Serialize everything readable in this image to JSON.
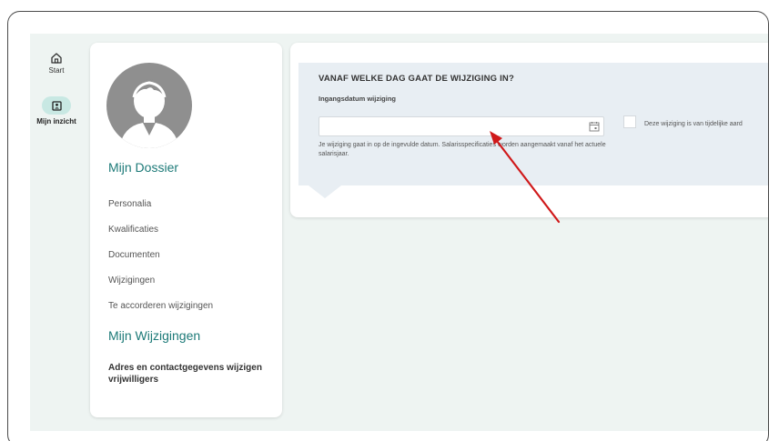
{
  "rail": {
    "items": [
      {
        "label": "Start",
        "icon": "home-icon"
      },
      {
        "label": "Mijn inzicht",
        "icon": "id-card-icon",
        "active": true
      }
    ]
  },
  "profile": {
    "avatar_icon": "avatar-icon",
    "dossier_title": "Mijn Dossier",
    "nav": [
      {
        "label": "Personalia"
      },
      {
        "label": "Kwalificaties"
      },
      {
        "label": "Documenten"
      },
      {
        "label": "Wijzigingen"
      },
      {
        "label": "Te accorderen wijzigingen"
      }
    ],
    "wijzigingen_title": "Mijn Wijzigingen",
    "adres_link": "Adres en contactgegevens wijzigen vrijwilligers"
  },
  "form": {
    "question": "VANAF WELKE DAG GAAT DE WIJZIGING IN?",
    "date_label": "Ingangsdatum wijziging",
    "date_value": "",
    "calendar_icon": "calendar-icon",
    "hint": "Je wijziging gaat in op de ingevulde datum. Salarisspecificaties worden aangemaakt vanaf het actuele salarisjaar.",
    "temporary_label": "Deze wijziging is van tijdelijke aard",
    "temporary_checked": false
  },
  "colors": {
    "accent": "#1d7a78",
    "rail_active": "#c8e8e3",
    "background": "#eef4f2",
    "panel": "#e8eef3",
    "annotation_arrow": "#d0191a"
  }
}
